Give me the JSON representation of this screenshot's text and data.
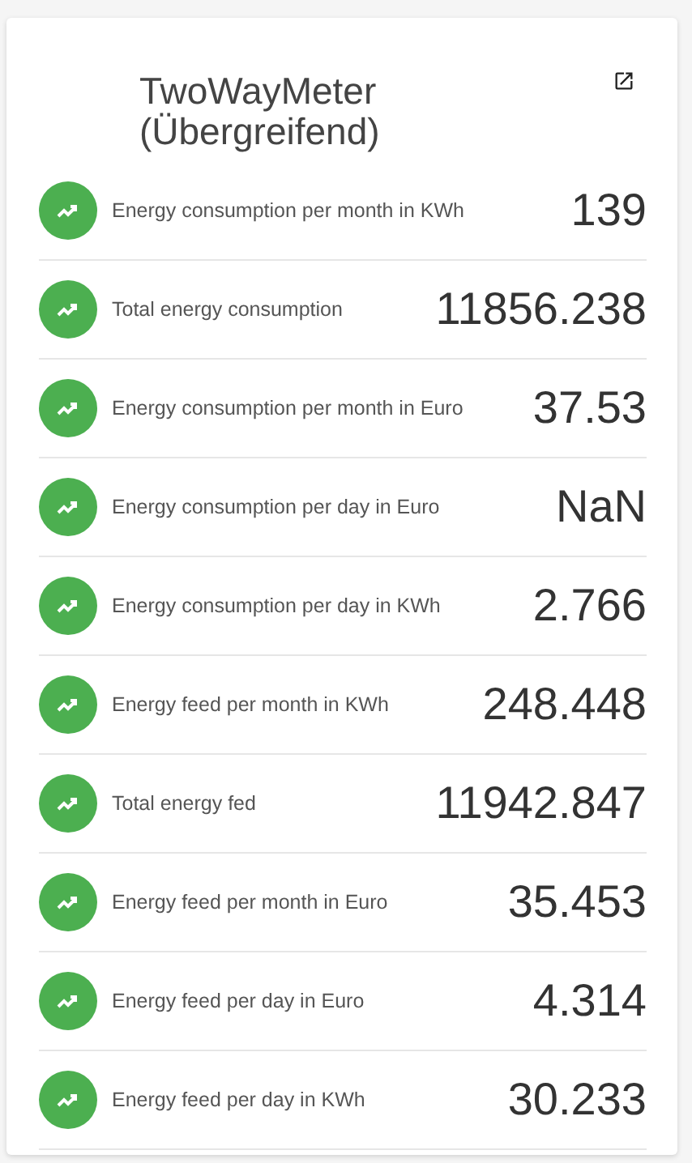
{
  "card": {
    "title": "TwoWayMeter (Übergreifend)"
  },
  "rows": [
    {
      "label": "Energy consumption per month in KWh",
      "value": "139"
    },
    {
      "label": "Total energy consumption",
      "value": "11856.238"
    },
    {
      "label": "Energy consumption per month in Euro",
      "value": "37.53"
    },
    {
      "label": "Energy consumption per day in Euro",
      "value": "NaN"
    },
    {
      "label": "Energy consumption per day in KWh",
      "value": "2.766"
    },
    {
      "label": "Energy feed per month in KWh",
      "value": "248.448"
    },
    {
      "label": "Total energy fed",
      "value": "11942.847"
    },
    {
      "label": "Energy feed per month in Euro",
      "value": "35.453"
    },
    {
      "label": "Energy feed per day in Euro",
      "value": "4.314"
    },
    {
      "label": "Energy feed per day in KWh",
      "value": "30.233"
    }
  ]
}
